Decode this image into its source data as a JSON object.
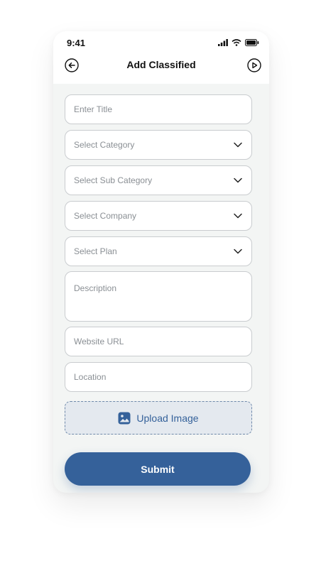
{
  "status_bar": {
    "time": "9:41"
  },
  "header": {
    "title": "Add Classified"
  },
  "form": {
    "title_placeholder": "Enter Title",
    "category_placeholder": "Select Category",
    "sub_category_placeholder": "Select Sub Category",
    "company_placeholder": "Select Company",
    "plan_placeholder": "Select Plan",
    "description_placeholder": "Description",
    "website_placeholder": "Website URL",
    "location_placeholder": "Location",
    "upload_label": "Upload Image",
    "submit_label": "Submit"
  },
  "colors": {
    "accent": "#35619a",
    "field_border": "#c9cccf",
    "upload_bg": "#e4e9ef",
    "screen_bg": "#f3f5f4"
  },
  "icons": [
    "back-arrow-icon",
    "play-circle-icon",
    "chevron-down-icon",
    "image-icon",
    "signal-icon",
    "wifi-icon",
    "battery-icon"
  ]
}
